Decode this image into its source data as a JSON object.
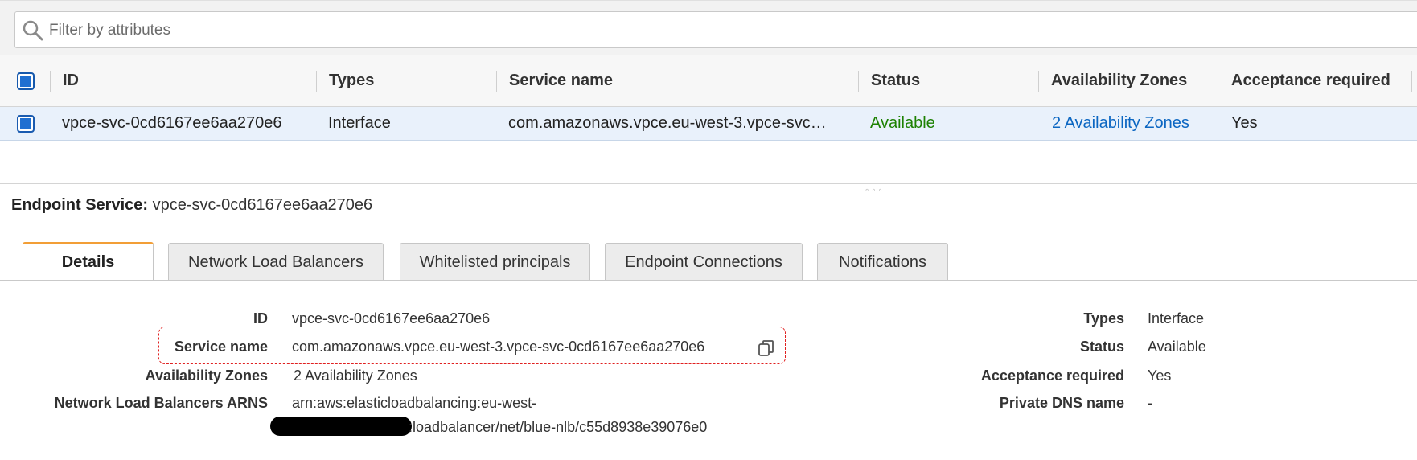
{
  "filter": {
    "placeholder": "Filter by attributes"
  },
  "table": {
    "headers": [
      "ID",
      "Types",
      "Service name",
      "Status",
      "Availability Zones",
      "Acceptance required"
    ],
    "row": {
      "id": "vpce-svc-0cd6167ee6aa270e6",
      "type": "Interface",
      "service_name": "com.amazonaws.vpce.eu-west-3.vpce-svc…",
      "status": "Available",
      "azs": "2 Availability Zones",
      "acceptance": "Yes"
    }
  },
  "endpoint": {
    "label": "Endpoint Service:",
    "value": "vpce-svc-0cd6167ee6aa270e6"
  },
  "tabs": [
    "Details",
    "Network Load Balancers",
    "Whitelisted principals",
    "Endpoint Connections",
    "Notifications"
  ],
  "details": {
    "left": [
      {
        "label": "ID",
        "value": "vpce-svc-0cd6167ee6aa270e6"
      },
      {
        "label": "Service name",
        "value": "com.amazonaws.vpce.eu-west-3.vpce-svc-0cd6167ee6aa270e6"
      },
      {
        "label": "Availability Zones",
        "value": "2 Availability Zones"
      },
      {
        "label": "Network Load Balancers ARNS",
        "value": "arn:aws:elasticloadbalancing:eu-west-",
        "value2": ":loadbalancer/net/blue-nlb/c55d8938e39076e0"
      }
    ],
    "right": [
      {
        "label": "Types",
        "value": "Interface"
      },
      {
        "label": "Status",
        "value": "Available"
      },
      {
        "label": "Acceptance required",
        "value": "Yes"
      },
      {
        "label": "Private DNS name",
        "value": "-"
      }
    ]
  },
  "colors": {
    "available": "#1d8102",
    "link": "#0b66c2",
    "tab_accent": "#f29e36",
    "highlight": "#e02020"
  }
}
